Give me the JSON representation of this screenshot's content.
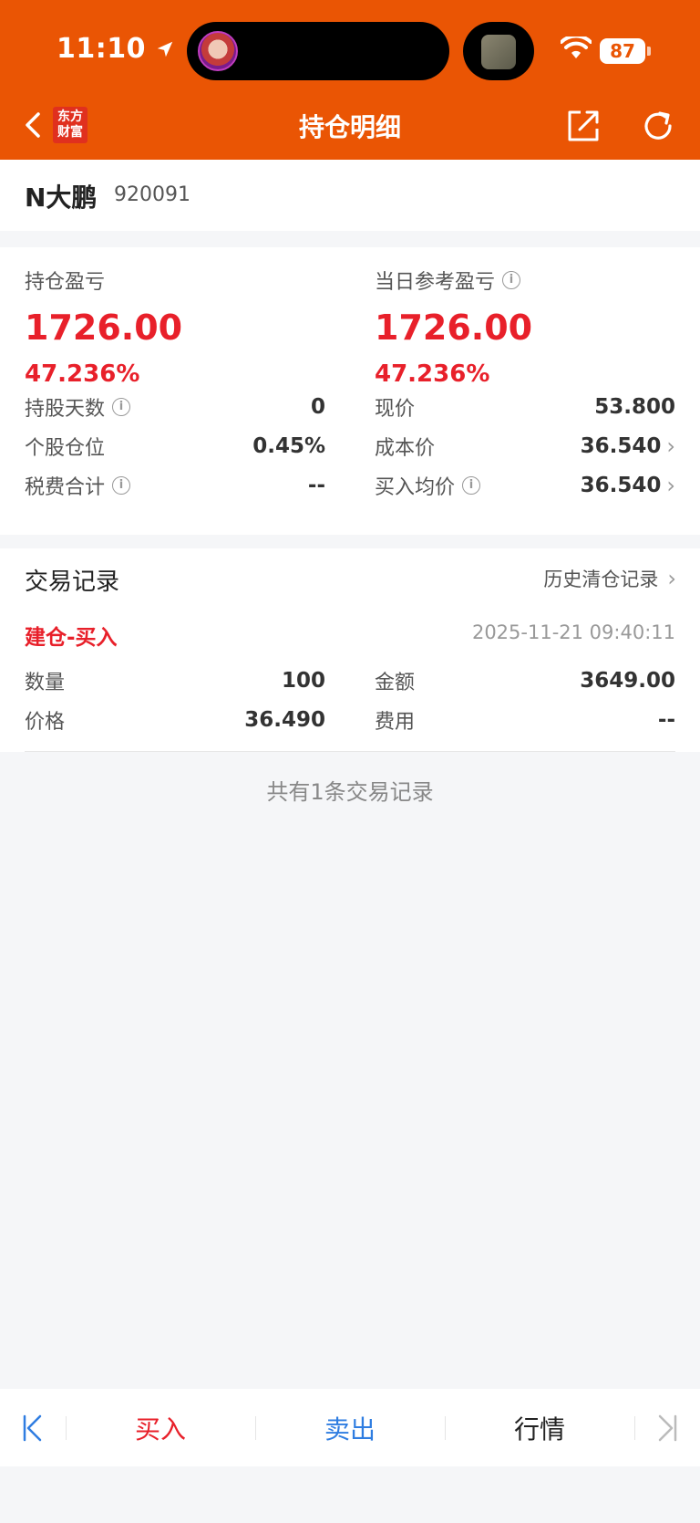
{
  "status": {
    "time": "11:10",
    "battery": "87"
  },
  "nav": {
    "logo_line1": "东方",
    "logo_line2": "财富",
    "title": "持仓明细"
  },
  "stock": {
    "name": "N大鹏",
    "code": "920091"
  },
  "pnl": {
    "holding_label": "持仓盈亏",
    "holding_value": "1726.00",
    "holding_pct": "47.236%",
    "daily_label": "当日参考盈亏",
    "daily_value": "1726.00",
    "daily_pct": "47.236%"
  },
  "details": {
    "left": [
      {
        "label": "持股天数",
        "value": "0",
        "info": true
      },
      {
        "label": "个股仓位",
        "value": "0.45%",
        "info": false
      },
      {
        "label": "税费合计",
        "value": "--",
        "info": true
      }
    ],
    "right": [
      {
        "label": "现价",
        "value": "53.800",
        "info": false,
        "chevron": false
      },
      {
        "label": "成本价",
        "value": "36.540",
        "info": false,
        "chevron": true
      },
      {
        "label": "买入均价",
        "value": "36.540",
        "info": true,
        "chevron": true
      }
    ]
  },
  "trades": {
    "title": "交易记录",
    "history_link": "历史清仓记录",
    "record": {
      "type": "建仓-买入",
      "time": "2025-11-21 09:40:11",
      "qty_label": "数量",
      "qty": "100",
      "amount_label": "金额",
      "amount": "3649.00",
      "price_label": "价格",
      "price": "36.490",
      "fee_label": "费用",
      "fee": "--"
    },
    "count_text": "共有1条交易记录"
  },
  "bottom": {
    "buy": "买入",
    "sell": "卖出",
    "quote": "行情"
  },
  "colors": {
    "brand": "#ea5504",
    "up": "#e8202a",
    "sell": "#2f7de1"
  }
}
